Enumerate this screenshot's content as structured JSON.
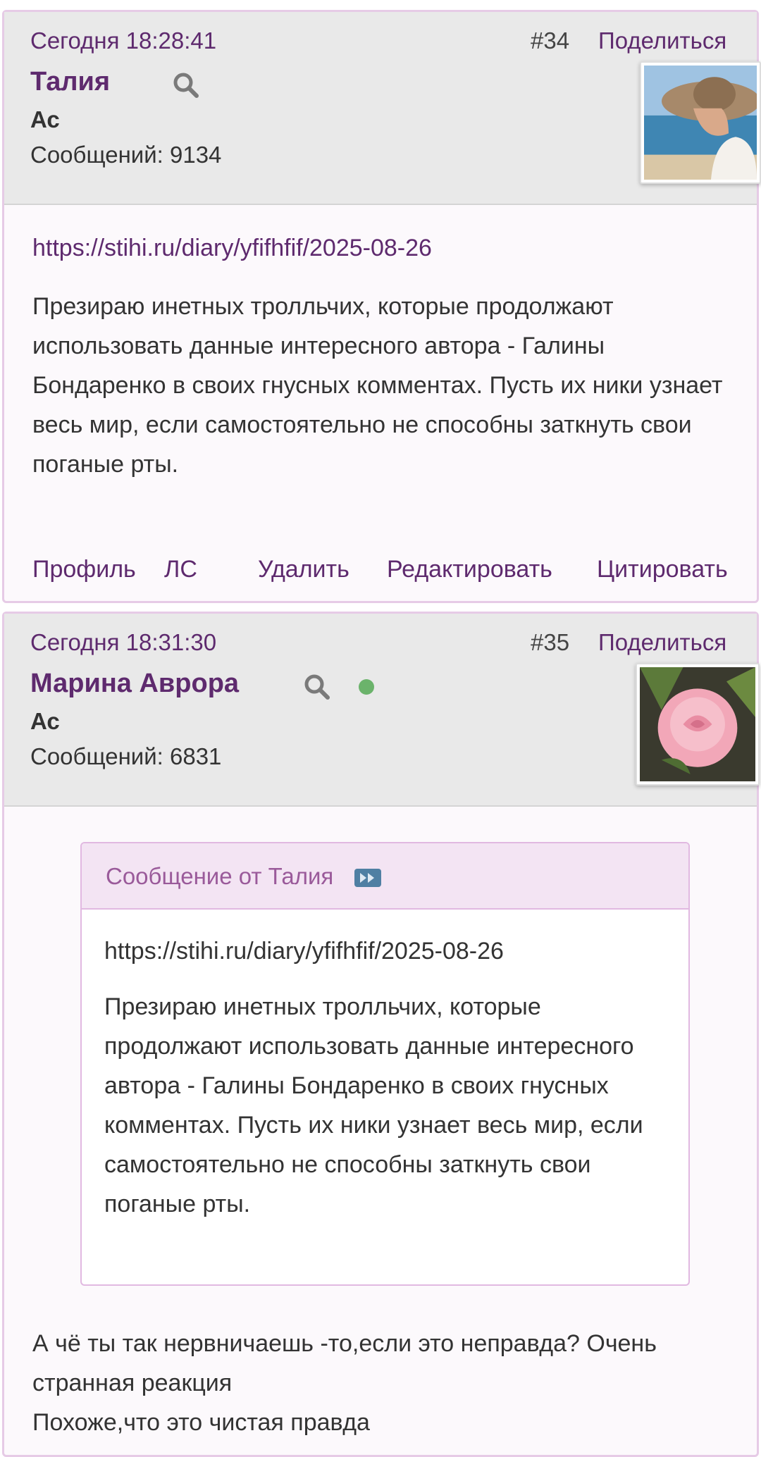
{
  "posts": [
    {
      "date": "Сегодня 18:28:41",
      "number": "#34",
      "share_label": "Поделиться",
      "author": "Талия",
      "rank": "Ас",
      "messages": "Сообщений: 9134",
      "online": false,
      "link": "https://stihi.ru/diary/yfifhfif/2025-08-26",
      "text": "Презираю инетных тролльчих,  которые продолжают использовать данные интересного автора - Галины Бондаренко в своих гнусных комментах. Пусть их ники узнает весь мир, если самостоятельно не способны заткнуть свои поганые рты.",
      "actions": [
        "Профиль",
        "ЛС",
        "Удалить",
        "Редактировать",
        "Цитировать"
      ]
    },
    {
      "date": "Сегодня 18:31:30",
      "number": "#35",
      "share_label": "Поделиться",
      "author": "Марина Аврора",
      "rank": "Ас",
      "messages": "Сообщений: 6831",
      "online": true,
      "quote": {
        "title": "Сообщение от Талия",
        "link": "https://stihi.ru/diary/yfifhfif/2025-08-26",
        "text": "Презираю инетных тролльчих,  которые продолжают использовать данные интересного автора - Галины Бондаренко в своих гнусных комментах. Пусть их ники узнает весь мир, если самостоятельно не способны заткнуть свои поганые рты."
      },
      "reply_lines": [
        "А чё ты так нервничаешь -то,если это неправда? Очень",
        "странная реакция",
        "Похоже,что это чистая правда"
      ]
    }
  ],
  "colors": {
    "accent": "#5e2a6e",
    "header_bg": "#e9e9e9",
    "post_border": "#e6cbe6",
    "quote_header_bg": "#f3e4f3",
    "online": "#6bb36b"
  }
}
